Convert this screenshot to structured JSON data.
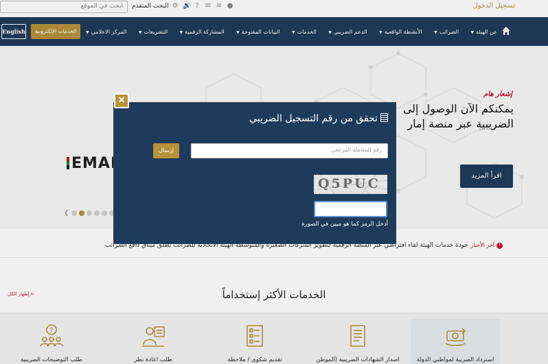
{
  "topbar": {
    "login": "تسجيل الدخول",
    "search_placeholder": "ابحث في الموقع",
    "advanced_search": "البحث المتقدم",
    "icons": [
      "accessibility-icon",
      "wifi-icon",
      "mail-icon",
      "help-icon",
      "sound-icon",
      "settings-icon"
    ]
  },
  "nav": {
    "english": "English",
    "e_services": "الخدمات الإلكترونية",
    "items": [
      "المركز الاعلامي",
      "التشريعات",
      "المشاركة الرقمية",
      "البيانات المفتوحة",
      "الخدمات",
      "الدعم الضريبي",
      "الأنشطة الواقعية",
      "الضرائب",
      "عن الهيئة"
    ]
  },
  "hero": {
    "notice": "إشعار هام",
    "headline_1": "يمكنكم الآن الوصول إلى",
    "headline_2": "الضريبية عبر منصة إمار",
    "read_more": "اقرأ المزيد",
    "logo_text": "EMAR"
  },
  "ticker": {
    "label": "آخر الأخبار",
    "text": "جودة خدمات الهيئة   لقاء افتراضي عبر المنصة الرقمية لتطوير الشركات الصغيرة والمتوسطة   الهيئة الاتحادية للضرائب تُطلق ميثاق دافع الضرائب"
  },
  "services": {
    "title": "الخدمات الأكثر إستخداماً",
    "show_all": "إظهار الكل",
    "items": [
      {
        "label": "استرداد الضريبة لمواطني الدولة",
        "icon": "money-refund-icon"
      },
      {
        "label": "اصدار الشهادات الضريبية (الموطن",
        "icon": "certificate-icon"
      },
      {
        "label": "تقديم شكوى / ملاحظة",
        "icon": "complaint-icon"
      },
      {
        "label": "طلب اعادة نظر",
        "icon": "review-request-icon"
      },
      {
        "label": "طلب التوضيحات الضريبية",
        "icon": "clarification-icon"
      }
    ]
  },
  "modal": {
    "close": "×",
    "title": "تحقق من رقم التسجيل الضريبي",
    "reference_placeholder": "رقم المعاملة المرجعي",
    "send": "إرسال",
    "captcha_code": "Q5PUC",
    "captcha_hint": "أدخل الرمز كما هو مبين في الصورة"
  },
  "colors": {
    "navy": "#1f3b5b",
    "gold": "#b8913b",
    "red": "#c8102e"
  }
}
